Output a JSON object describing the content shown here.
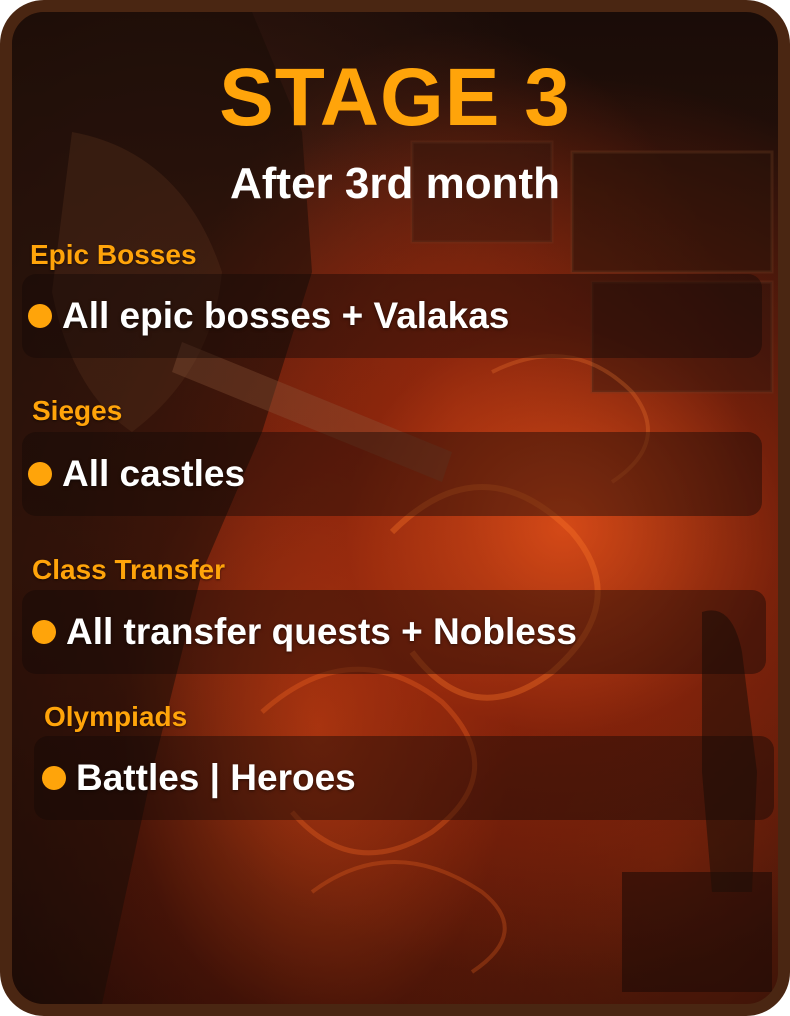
{
  "header": {
    "title": "STAGE 3",
    "subtitle": "After 3rd month"
  },
  "sections": [
    {
      "label": "Epic Bosses",
      "item": "All epic bosses + Valakas"
    },
    {
      "label": "Sieges",
      "item": "All castles"
    },
    {
      "label": "Class Transfer",
      "item": "All transfer quests + Nobless"
    },
    {
      "label": "Olympiads",
      "item": "Battles | Heroes"
    }
  ],
  "colors": {
    "accent": "#ffa40a",
    "text": "#ffffff",
    "border": "#4a2612"
  }
}
